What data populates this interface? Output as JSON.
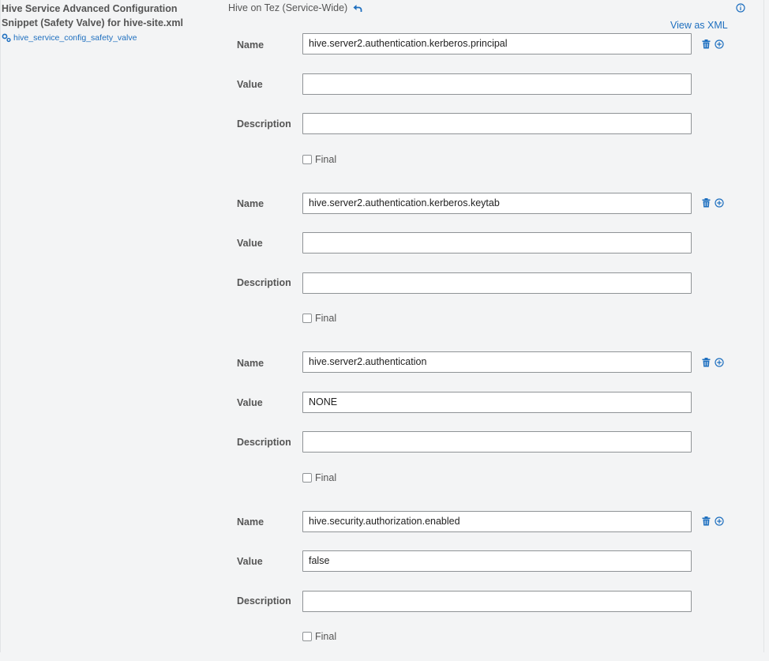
{
  "property": {
    "title": "Hive Service Advanced Configuration Snippet (Safety Valve) for hive-site.xml",
    "config_key": "hive_service_config_safety_valve",
    "scope": "Hive on Tez (Service-Wide)",
    "view_xml": "View as XML"
  },
  "labels": {
    "name": "Name",
    "value": "Value",
    "description": "Description",
    "final": "Final"
  },
  "entries": [
    {
      "name": "hive.server2.authentication.kerberos.principal",
      "value": "",
      "description": "",
      "final": false
    },
    {
      "name": "hive.server2.authentication.kerberos.keytab",
      "value": "",
      "description": "",
      "final": false
    },
    {
      "name": "hive.server2.authentication",
      "value": "NONE",
      "description": "",
      "final": false
    },
    {
      "name": "hive.security.authorization.enabled",
      "value": "false",
      "description": "",
      "final": false
    }
  ],
  "colors": {
    "link": "#1e6fbf",
    "background": "#f3f4f5",
    "label": "#555555"
  },
  "icons": {
    "config": "gears-icon",
    "undo": "undo-arrow-icon",
    "info": "info-circle-icon",
    "delete": "trash-icon",
    "add": "plus-circle-icon"
  }
}
